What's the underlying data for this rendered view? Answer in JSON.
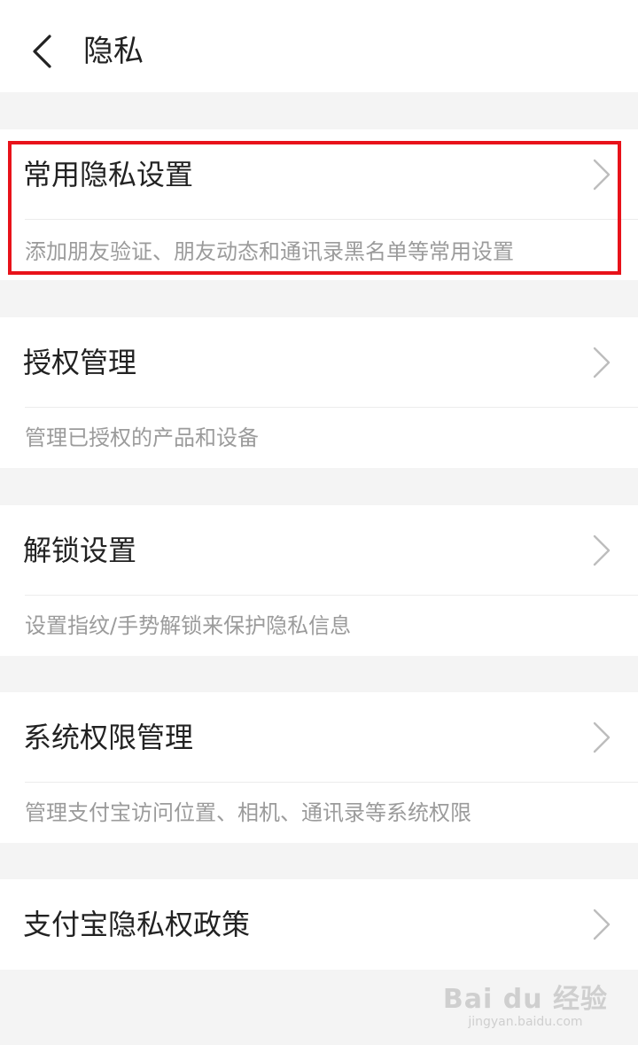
{
  "header": {
    "title": "隐私",
    "back_icon": "chevron-left-icon"
  },
  "items": [
    {
      "title": "常用隐私设置",
      "description": "添加朋友验证、朋友动态和通讯录黑名单等常用设置",
      "highlighted": true
    },
    {
      "title": "授权管理",
      "description": "管理已授权的产品和设备"
    },
    {
      "title": "解锁设置",
      "description": "设置指纹/手势解锁来保护隐私信息"
    },
    {
      "title": "系统权限管理",
      "description": "管理支付宝访问位置、相机、通讯录等系统权限"
    },
    {
      "title": "支付宝隐私权政策"
    }
  ],
  "colors": {
    "highlight": "#e8121a",
    "title_text": "#222222",
    "desc_text": "#9b9b9b",
    "background": "#f4f4f4"
  },
  "watermark": {
    "main": "Bai du 经验",
    "sub": "jingyan.baidu.com"
  }
}
